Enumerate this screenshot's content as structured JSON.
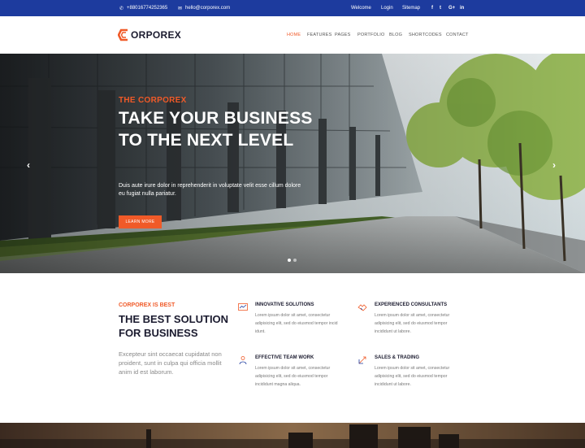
{
  "topbar": {
    "phone": "+88016774252365",
    "email": "hello@corporex.com",
    "links": [
      "Welcome",
      "Login",
      "Sitemap"
    ],
    "social": [
      "f",
      "t",
      "G+",
      "in"
    ]
  },
  "header": {
    "logo_text": "ORPOREX",
    "nav": [
      "HOME",
      "FEATURES",
      "PAGES",
      "PORTFOLIO",
      "BLOG",
      "SHORTCODES",
      "CONTACT"
    ]
  },
  "hero": {
    "eyebrow": "THE CORPOREX",
    "title": "TAKE YOUR BUSINESS TO THE NEXT LEVEL",
    "description": "Duis aute irure dolor in reprehenderit in voluptate velit esse cillum dolore eu fugiat nulla pariatur.",
    "cta": "LEARN MORE",
    "prev": "‹",
    "next": "›"
  },
  "section": {
    "eyebrow": "CORPOREX IS BEST",
    "title": "THE BEST SOLUTION FOR BUSINESS",
    "text": "Excepteur sint occaecat cupidatat non proident, sunt in culpa qui officia mollit anim id est laborum.",
    "features": [
      {
        "icon": "chart-icon",
        "title": "INNOVATIVE SOLUTIONS",
        "text": "Lorem ipsum dolor sit amet, consectetur adipisicing elit, sed do eiusmod tempor incid idunt."
      },
      {
        "icon": "handshake-icon",
        "title": "EXPERIENCED CONSULTANTS",
        "text": "Lorem ipsum dolor sit amet, consectetur adipisicing elit, sed do eiusmod tempor incididunt ut labore."
      },
      {
        "icon": "team-icon",
        "title": "EFFECTIVE TEAM WORK",
        "text": "Lorem ipsum dolor sit amet, consectetur adipisicing elit, sed do eiusmod tempor incididunt magna aliqua."
      },
      {
        "icon": "trade-icon",
        "title": "SALES & TRADING",
        "text": "Lorem ipsum dolor sit amet, consectetur adipisicing elit, sed do eiusmod tempor incididunt ut labore."
      }
    ]
  },
  "colors": {
    "accent": "#f05a28",
    "topbar": "#1d3b9e",
    "text": "#1b1b2f"
  }
}
